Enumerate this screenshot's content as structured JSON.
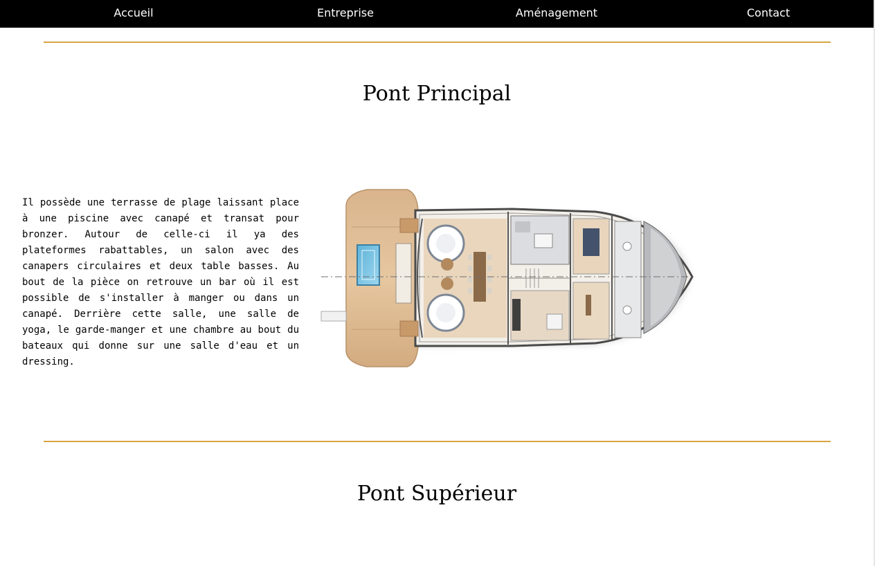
{
  "nav": {
    "items": [
      "Accueil",
      "Entreprise",
      "Aménagement",
      "Contact"
    ]
  },
  "sections": [
    {
      "title": "Pont Principal",
      "text": "Il possède une terrasse de plage laissant place à une piscine avec canapé et transat pour bronzer. Autour de celle-ci il ya des plateformes rabattables, un salon avec des canapers circulaires et deux table basses. Au bout de la pièce on retrouve un bar où il est possible de s'installer à manger ou dans un canapé. Derrière cette salle, une salle de yoga, le garde-manger et une chambre au bout du bateaux qui donne sur une salle d'eau et un dressing."
    },
    {
      "title": "Pont Supérieur"
    }
  ],
  "colors": {
    "nav_background": "#000000",
    "nav_text": "#ffffff",
    "accent_rule": "#d9a441",
    "page_background": "#ffffff"
  }
}
